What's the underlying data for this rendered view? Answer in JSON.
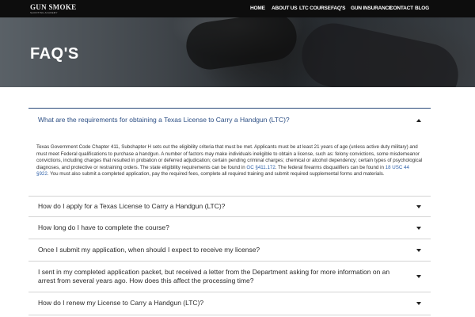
{
  "logo": {
    "main": "GUN SMOKE",
    "sub": "SHOOTING ACADEMY"
  },
  "nav": [
    {
      "label": "HOME"
    },
    {
      "label": "ABOUT US"
    },
    {
      "label": "LTC COURSE"
    },
    {
      "label": "FAQ'S"
    },
    {
      "label": "GUN INSURANCE"
    },
    {
      "label": "CONTACT"
    },
    {
      "label": "BLOG"
    }
  ],
  "hero": {
    "title": "FAQ'S"
  },
  "faq": {
    "expanded": {
      "question": "What are the requirements for obtaining a Texas License to Carry a Handgun (LTC)?",
      "answer_part1": "Texas Government Code Chapter 411, Subchapter H sets out the eligibility criteria that must be met. Applicants must be at least 21 years of age (unless active duty military) and must meet Federal qualifications to purchase a handgun. A number of factors may make individuals ineligible to obtain a license, such as: felony convictions, some misdemeanor convictions, including charges that resulted in probation or deferred adjudication; certain pending criminal charges; chemical or alcohol dependency; certain types of psychological diagnoses, and protective or restraining orders. The state eligibility requirements can be found in ",
      "link1": "GC §411.172",
      "answer_part2": ". The federal firearms disqualifiers can be found in ",
      "link2": "18 USC 44 §922",
      "answer_part3": ". You must also submit a completed application, pay the required fees, complete all required training and submit required supplemental forms and materials."
    },
    "items": [
      {
        "question": "How do I apply for a Texas License to Carry a Handgun (LTC)?"
      },
      {
        "question": "How long do I have to complete the course?"
      },
      {
        "question": "Once I submit my application, when should I expect to receive my license?"
      },
      {
        "question": "I sent in my completed application packet, but received a letter from the Department asking for more information on an arrest from several years ago. How does this affect the processing time?"
      },
      {
        "question": "How do I renew my License to Carry a Handgun (LTC)?"
      }
    ]
  }
}
